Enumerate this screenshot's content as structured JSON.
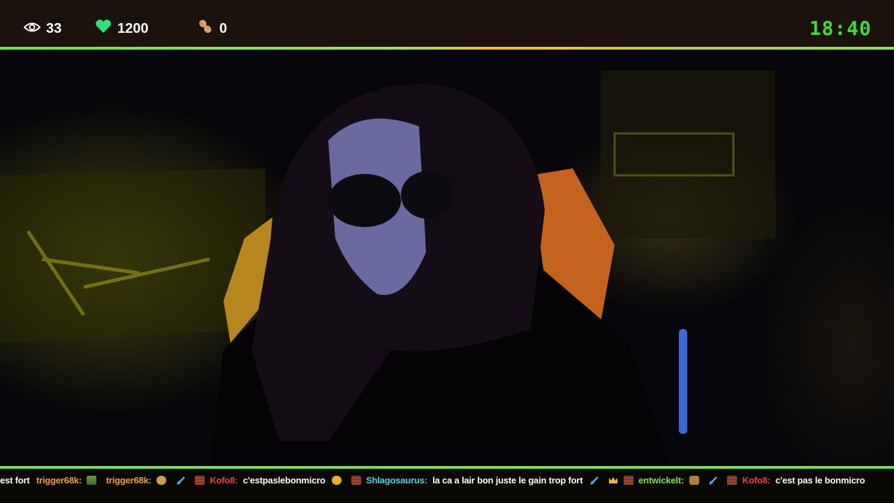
{
  "stats": {
    "viewers": "33",
    "likes": "1200",
    "peanuts": "0",
    "icons": [
      "eye-icon",
      "heart-icon",
      "peanut-icon"
    ]
  },
  "clock": "18:40",
  "colors": {
    "accent_green": "#74e03a",
    "heart": "#2ee07a",
    "clock": "#3ddc3a",
    "user_orange": "#f0a01e",
    "user_red": "#e8403a",
    "user_cyan": "#38d8e8",
    "user_green": "#7ee03a"
  },
  "chat": [
    {
      "user": "",
      "text": "est fort"
    },
    {
      "user": "trigger68k:",
      "text": "",
      "emote": "pixel-emote",
      "color": "#f0a01e"
    },
    {
      "user": "trigger68k:",
      "text": "",
      "emote": "face-emote",
      "color": "#f0a01e"
    },
    {
      "user": "",
      "text": "",
      "emote": "sword-icon"
    },
    {
      "user": "Kofo8:",
      "text": "c'estpaslebonmicro",
      "emote": "brick-emote",
      "color": "#e8403a"
    },
    {
      "user": "",
      "text": "",
      "emote": "coin-emote"
    },
    {
      "user": "Shlagosaurus:",
      "text": "la ca a lair bon juste le gain trop fort",
      "emote": "brick-emote",
      "color": "#38d8e8"
    },
    {
      "user": "",
      "text": "",
      "emote": "sword-icon"
    },
    {
      "user": "entwickelt:",
      "text": "",
      "emote": "crown-emote",
      "color": "#7ee03a"
    },
    {
      "user": "",
      "text": "",
      "emote": "sword-icon"
    },
    {
      "user": "Kofo8:",
      "text": "c'est pas le bonmicro",
      "emote": "brick-emote",
      "color": "#e8403a"
    }
  ]
}
